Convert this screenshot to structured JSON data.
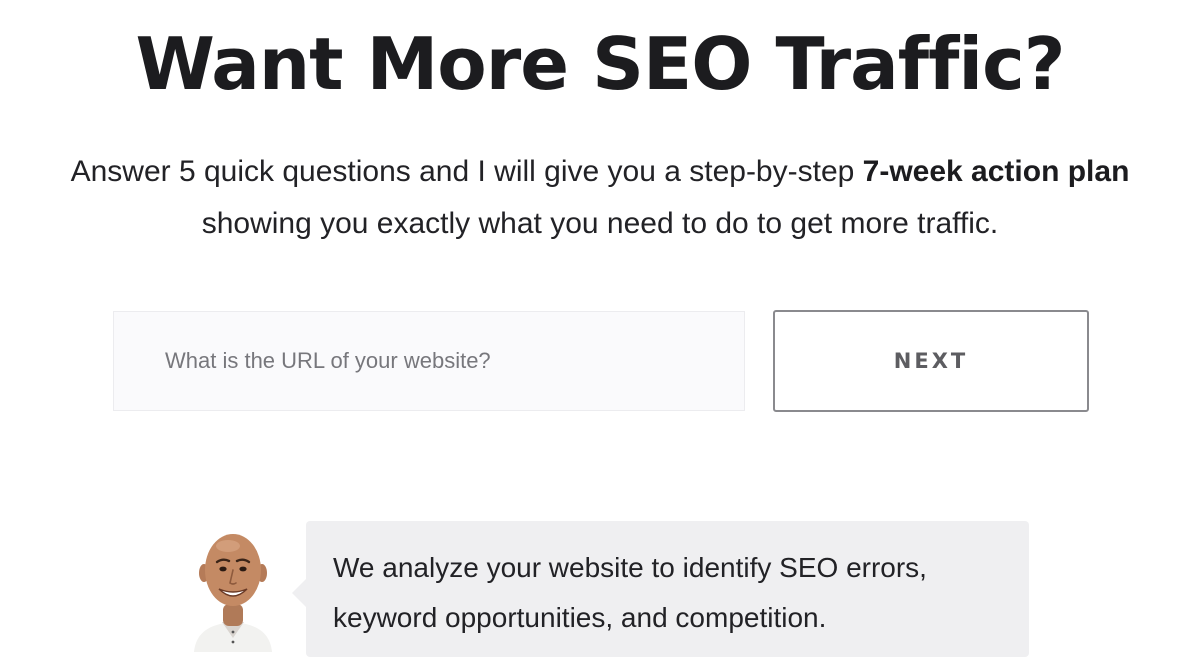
{
  "hero": {
    "title": "Want More SEO Traffic?",
    "subtitle_part1": "Answer 5 quick questions and I will give you a step-by-step ",
    "subtitle_bold": "7-week action plan",
    "subtitle_line2": "showing you exactly what you need to do to get more traffic."
  },
  "form": {
    "url_placeholder": "What is the URL of your website?",
    "url_value": "",
    "next_label": "NEXT"
  },
  "bubble": {
    "avatar_icon": "person-portrait-icon",
    "line1": "We analyze your website to identify SEO errors,",
    "line2": "keyword opportunities, and competition."
  },
  "colors": {
    "text": "#1f1f22",
    "input_bg": "#fafafc",
    "button_border": "#8a8a8e",
    "bubble_bg": "#efeff1"
  }
}
